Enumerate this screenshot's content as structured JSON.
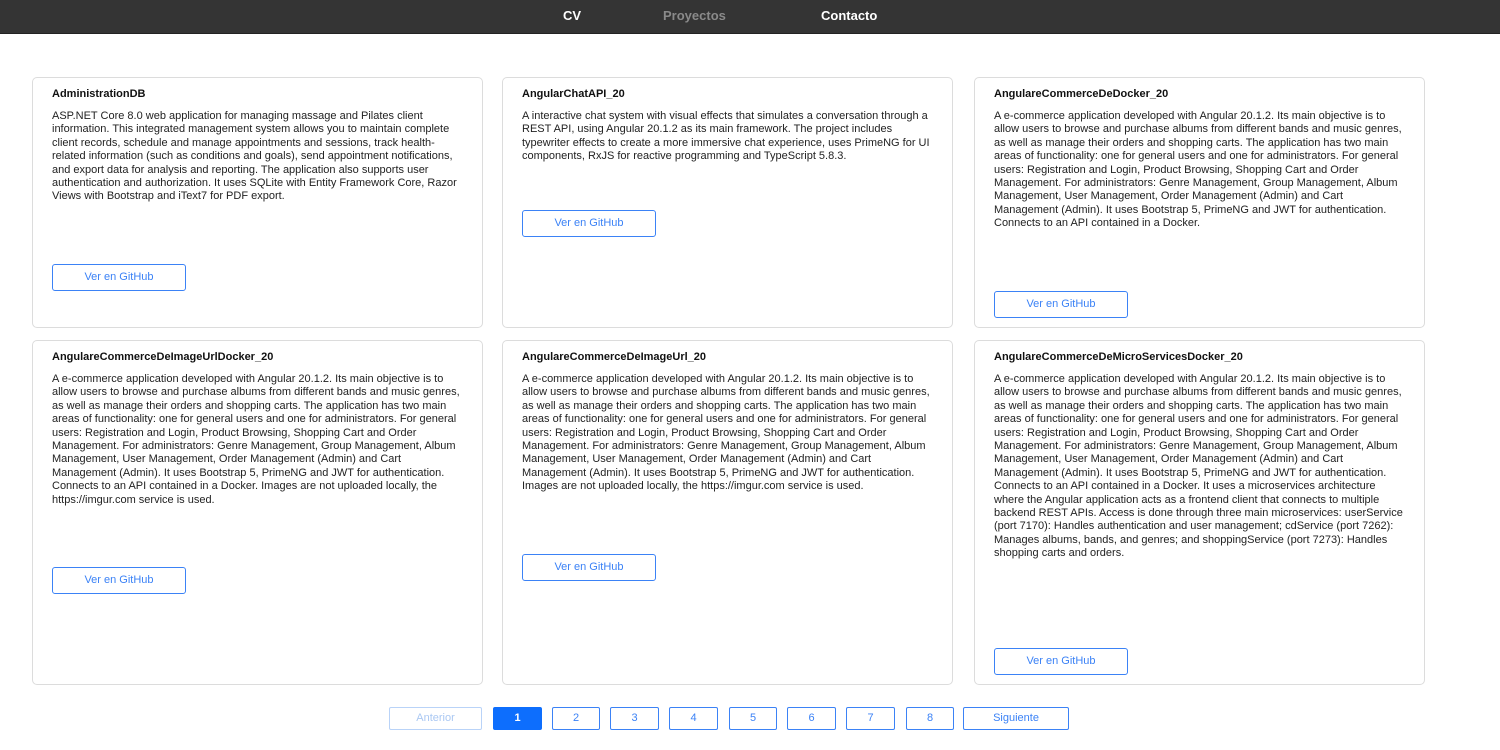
{
  "nav": {
    "cv": "CV",
    "projects": "Proyectos",
    "contact": "Contacto"
  },
  "cards": [
    {
      "title": "AdministrationDB",
      "description": "ASP.NET Core 8.0 web application for managing massage and Pilates client information. This integrated management system allows you to maintain complete client records, schedule and manage appointments and sessions, track health-related information (such as conditions and goals), send appointment notifications, and export data for analysis and reporting. The application also supports user authentication and authorization. It uses SQLite with Entity Framework Core, Razor Views with Bootstrap and iText7 for PDF export.",
      "button": "Ver en GitHub"
    },
    {
      "title": "AngularChatAPI_20",
      "description": "A interactive chat system with visual effects that simulates a conversation through a REST API, using Angular 20.1.2 as its main framework. The project includes typewriter effects to create a more immersive chat experience, uses PrimeNG for UI components, RxJS for reactive programming and TypeScript 5.8.3.",
      "button": "Ver en GitHub"
    },
    {
      "title": "AngulareCommerceDeDocker_20",
      "description": "A e-commerce application developed with Angular 20.1.2. Its main objective is to allow users to browse and purchase albums from different bands and music genres, as well as manage their orders and shopping carts. The application has two main areas of functionality: one for general users and one for administrators. For general users: Registration and Login, Product Browsing, Shopping Cart and Order Management. For administrators: Genre Management, Group Management, Album Management, User Management, Order Management (Admin) and Cart Management (Admin). It uses Bootstrap 5, PrimeNG and JWT for authentication. Connects to an API contained in a Docker.",
      "button": "Ver en GitHub"
    },
    {
      "title": "AngulareCommerceDeImageUrlDocker_20",
      "description": "A e-commerce application developed with Angular 20.1.2. Its main objective is to allow users to browse and purchase albums from different bands and music genres, as well as manage their orders and shopping carts. The application has two main areas of functionality: one for general users and one for administrators. For general users: Registration and Login, Product Browsing, Shopping Cart and Order Management. For administrators: Genre Management, Group Management, Album Management, User Management, Order Management (Admin) and Cart Management (Admin). It uses Bootstrap 5, PrimeNG and JWT for authentication. Connects to an API contained in a Docker. Images are not uploaded locally, the https://imgur.com service is used.",
      "button": "Ver en GitHub"
    },
    {
      "title": "AngulareCommerceDeImageUrl_20",
      "description": "A e-commerce application developed with Angular 20.1.2. Its main objective is to allow users to browse and purchase albums from different bands and music genres, as well as manage their orders and shopping carts. The application has two main areas of functionality: one for general users and one for administrators. For general users: Registration and Login, Product Browsing, Shopping Cart and Order Management. For administrators: Genre Management, Group Management, Album Management, User Management, Order Management (Admin) and Cart Management (Admin). It uses Bootstrap 5, PrimeNG and JWT for authentication. Images are not uploaded locally, the https://imgur.com service is used.",
      "button": "Ver en GitHub"
    },
    {
      "title": "AngulareCommerceDeMicroServicesDocker_20",
      "description": "A e-commerce application developed with Angular 20.1.2. Its main objective is to allow users to browse and purchase albums from different bands and music genres, as well as manage their orders and shopping carts. The application has two main areas of functionality: one for general users and one for administrators. For general users: Registration and Login, Product Browsing, Shopping Cart and Order Management. For administrators: Genre Management, Group Management, Album Management, User Management, Order Management (Admin) and Cart Management (Admin). It uses Bootstrap 5, PrimeNG and JWT for authentication. Connects to an API contained in a Docker. It uses a microservices architecture where the Angular application acts as a frontend client that connects to multiple backend REST APIs. Access is done through three main microservices: userService (port 7170): Handles authentication and user management; cdService (port 7262): Manages albums, bands, and genres; and shoppingService (port 7273): Handles shopping carts and orders.",
      "button": "Ver en GitHub"
    }
  ],
  "pagination": {
    "prev": "Anterior",
    "pages": [
      "1",
      "2",
      "3",
      "4",
      "5",
      "6",
      "7",
      "8"
    ],
    "current": "1",
    "next": "Siguiente"
  },
  "colors": {
    "navbar": "#343434",
    "accent": "#3b82f6",
    "active_page": "#0d6efd"
  }
}
